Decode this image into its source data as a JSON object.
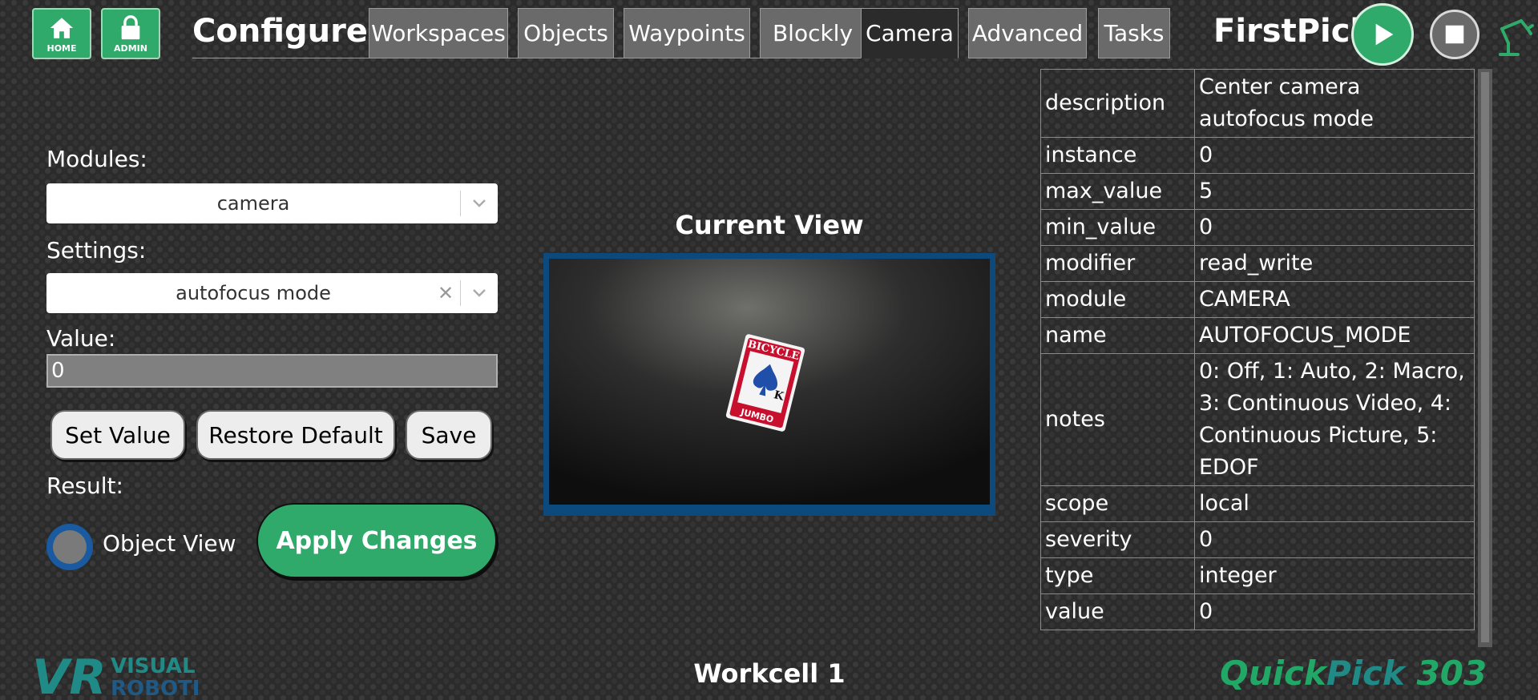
{
  "header": {
    "home_label": "HOME",
    "admin_label": "ADMIN",
    "title": "Configure",
    "tabs": [
      "Workspaces",
      "Objects",
      "Waypoints",
      "Blockly",
      "Camera",
      "Advanced",
      "Tasks"
    ],
    "active_tab": "Camera",
    "project_name": "FirstPick"
  },
  "form": {
    "modules_label": "Modules:",
    "modules_value": "camera",
    "settings_label": "Settings:",
    "settings_value": "autofocus mode",
    "value_label": "Value:",
    "value": "0",
    "set_value_label": "Set Value",
    "restore_default_label": "Restore Default",
    "save_label": "Save",
    "result_label": "Result:",
    "object_view_label": "Object View",
    "apply_label": "Apply Changes"
  },
  "view": {
    "title": "Current View",
    "card_brand": "BICYCLE",
    "card_size": "JUMBO"
  },
  "properties": [
    {
      "key": "description",
      "value": "Center camera autofocus mode"
    },
    {
      "key": "instance",
      "value": "0"
    },
    {
      "key": "max_value",
      "value": "5"
    },
    {
      "key": "min_value",
      "value": "0"
    },
    {
      "key": "modifier",
      "value": "read_write"
    },
    {
      "key": "module",
      "value": "CAMERA"
    },
    {
      "key": "name",
      "value": "AUTOFOCUS_MODE"
    },
    {
      "key": "notes",
      "value": "0: Off, 1: Auto, 2: Macro, 3: Continuous Video, 4: Continuous Picture, 5: EDOF"
    },
    {
      "key": "scope",
      "value": "local"
    },
    {
      "key": "severity",
      "value": "0"
    },
    {
      "key": "type",
      "value": "integer"
    },
    {
      "key": "value",
      "value": "0"
    }
  ],
  "footer": {
    "workcell": "Workcell 1",
    "brand_quick": "Quick",
    "brand_pick": "Pick",
    "brand_num": "303",
    "logo_vr": "VR",
    "logo_line1": "VISUAL",
    "logo_line2": "ROBOTICS"
  },
  "colors": {
    "accent_green": "#2faa6b",
    "tab_gray": "#6a6a6a",
    "frame_blue": "#0c4a7d",
    "brand_green": "#22a866",
    "logo_teal": "#1f8a86"
  }
}
